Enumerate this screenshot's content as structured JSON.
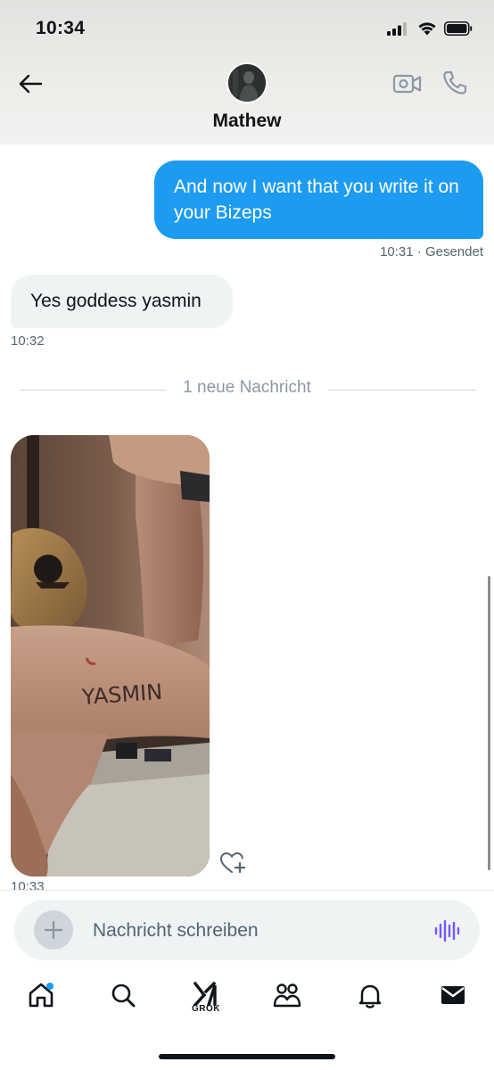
{
  "status_bar": {
    "time": "10:34"
  },
  "header": {
    "contact_name": "Mathew"
  },
  "messages": {
    "outgoing": {
      "text": "And now I want that you write it on your Bizeps",
      "time": "10:31",
      "separator": "·",
      "status": "Gesendet"
    },
    "incoming": {
      "text": "Yes goddess yasmin",
      "time": "10:32"
    },
    "new_divider": "1 neue Nachricht",
    "photo": {
      "caption_text": "YASMIN",
      "time": "10:33"
    }
  },
  "composer": {
    "placeholder": "Nachricht schreiben"
  },
  "nav": {
    "grok_label": "GROK"
  },
  "icons": [
    "back-arrow-icon",
    "video-call-icon",
    "phone-icon",
    "heart-plus-icon",
    "plus-icon",
    "voice-wave-icon",
    "home-icon",
    "search-icon",
    "grok-icon",
    "communities-icon",
    "bell-icon",
    "mail-icon"
  ],
  "colors": {
    "accent": "#1d9bf0",
    "voice": "#7856ff",
    "text": "#0f1419",
    "muted": "#536471"
  }
}
